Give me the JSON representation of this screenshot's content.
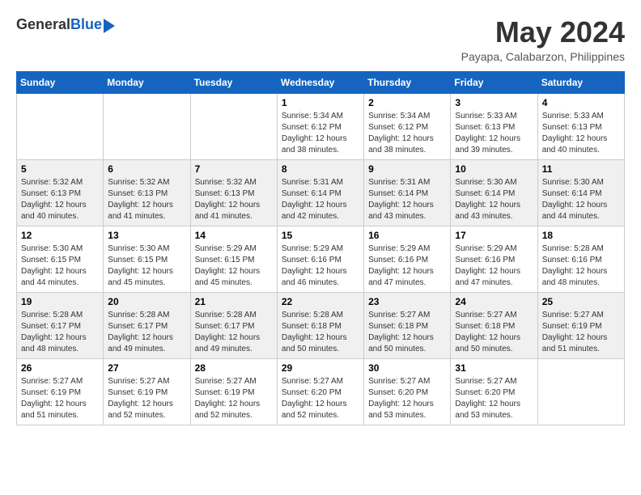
{
  "logo": {
    "general": "General",
    "blue": "Blue"
  },
  "title": {
    "month_year": "May 2024",
    "location": "Payapa, Calabarzon, Philippines"
  },
  "weekdays": [
    "Sunday",
    "Monday",
    "Tuesday",
    "Wednesday",
    "Thursday",
    "Friday",
    "Saturday"
  ],
  "weeks": [
    [
      {
        "day": "",
        "info": ""
      },
      {
        "day": "",
        "info": ""
      },
      {
        "day": "",
        "info": ""
      },
      {
        "day": "1",
        "info": "Sunrise: 5:34 AM\nSunset: 6:12 PM\nDaylight: 12 hours\nand 38 minutes."
      },
      {
        "day": "2",
        "info": "Sunrise: 5:34 AM\nSunset: 6:12 PM\nDaylight: 12 hours\nand 38 minutes."
      },
      {
        "day": "3",
        "info": "Sunrise: 5:33 AM\nSunset: 6:13 PM\nDaylight: 12 hours\nand 39 minutes."
      },
      {
        "day": "4",
        "info": "Sunrise: 5:33 AM\nSunset: 6:13 PM\nDaylight: 12 hours\nand 40 minutes."
      }
    ],
    [
      {
        "day": "5",
        "info": "Sunrise: 5:32 AM\nSunset: 6:13 PM\nDaylight: 12 hours\nand 40 minutes."
      },
      {
        "day": "6",
        "info": "Sunrise: 5:32 AM\nSunset: 6:13 PM\nDaylight: 12 hours\nand 41 minutes."
      },
      {
        "day": "7",
        "info": "Sunrise: 5:32 AM\nSunset: 6:13 PM\nDaylight: 12 hours\nand 41 minutes."
      },
      {
        "day": "8",
        "info": "Sunrise: 5:31 AM\nSunset: 6:14 PM\nDaylight: 12 hours\nand 42 minutes."
      },
      {
        "day": "9",
        "info": "Sunrise: 5:31 AM\nSunset: 6:14 PM\nDaylight: 12 hours\nand 43 minutes."
      },
      {
        "day": "10",
        "info": "Sunrise: 5:30 AM\nSunset: 6:14 PM\nDaylight: 12 hours\nand 43 minutes."
      },
      {
        "day": "11",
        "info": "Sunrise: 5:30 AM\nSunset: 6:14 PM\nDaylight: 12 hours\nand 44 minutes."
      }
    ],
    [
      {
        "day": "12",
        "info": "Sunrise: 5:30 AM\nSunset: 6:15 PM\nDaylight: 12 hours\nand 44 minutes."
      },
      {
        "day": "13",
        "info": "Sunrise: 5:30 AM\nSunset: 6:15 PM\nDaylight: 12 hours\nand 45 minutes."
      },
      {
        "day": "14",
        "info": "Sunrise: 5:29 AM\nSunset: 6:15 PM\nDaylight: 12 hours\nand 45 minutes."
      },
      {
        "day": "15",
        "info": "Sunrise: 5:29 AM\nSunset: 6:16 PM\nDaylight: 12 hours\nand 46 minutes."
      },
      {
        "day": "16",
        "info": "Sunrise: 5:29 AM\nSunset: 6:16 PM\nDaylight: 12 hours\nand 47 minutes."
      },
      {
        "day": "17",
        "info": "Sunrise: 5:29 AM\nSunset: 6:16 PM\nDaylight: 12 hours\nand 47 minutes."
      },
      {
        "day": "18",
        "info": "Sunrise: 5:28 AM\nSunset: 6:16 PM\nDaylight: 12 hours\nand 48 minutes."
      }
    ],
    [
      {
        "day": "19",
        "info": "Sunrise: 5:28 AM\nSunset: 6:17 PM\nDaylight: 12 hours\nand 48 minutes."
      },
      {
        "day": "20",
        "info": "Sunrise: 5:28 AM\nSunset: 6:17 PM\nDaylight: 12 hours\nand 49 minutes."
      },
      {
        "day": "21",
        "info": "Sunrise: 5:28 AM\nSunset: 6:17 PM\nDaylight: 12 hours\nand 49 minutes."
      },
      {
        "day": "22",
        "info": "Sunrise: 5:28 AM\nSunset: 6:18 PM\nDaylight: 12 hours\nand 50 minutes."
      },
      {
        "day": "23",
        "info": "Sunrise: 5:27 AM\nSunset: 6:18 PM\nDaylight: 12 hours\nand 50 minutes."
      },
      {
        "day": "24",
        "info": "Sunrise: 5:27 AM\nSunset: 6:18 PM\nDaylight: 12 hours\nand 50 minutes."
      },
      {
        "day": "25",
        "info": "Sunrise: 5:27 AM\nSunset: 6:19 PM\nDaylight: 12 hours\nand 51 minutes."
      }
    ],
    [
      {
        "day": "26",
        "info": "Sunrise: 5:27 AM\nSunset: 6:19 PM\nDaylight: 12 hours\nand 51 minutes."
      },
      {
        "day": "27",
        "info": "Sunrise: 5:27 AM\nSunset: 6:19 PM\nDaylight: 12 hours\nand 52 minutes."
      },
      {
        "day": "28",
        "info": "Sunrise: 5:27 AM\nSunset: 6:19 PM\nDaylight: 12 hours\nand 52 minutes."
      },
      {
        "day": "29",
        "info": "Sunrise: 5:27 AM\nSunset: 6:20 PM\nDaylight: 12 hours\nand 52 minutes."
      },
      {
        "day": "30",
        "info": "Sunrise: 5:27 AM\nSunset: 6:20 PM\nDaylight: 12 hours\nand 53 minutes."
      },
      {
        "day": "31",
        "info": "Sunrise: 5:27 AM\nSunset: 6:20 PM\nDaylight: 12 hours\nand 53 minutes."
      },
      {
        "day": "",
        "info": ""
      }
    ]
  ]
}
